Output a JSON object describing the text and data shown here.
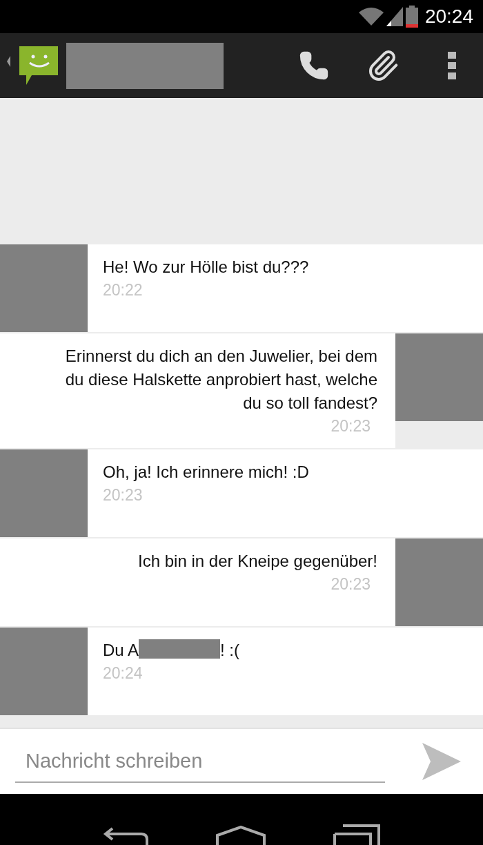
{
  "status_bar": {
    "time": "20:24",
    "battery_low": true
  },
  "action_bar": {
    "contact_redacted": true
  },
  "messages": [
    {
      "kind": "received",
      "segments": [
        {
          "kind": "text",
          "text": "He! Wo zur Hölle bist du???"
        }
      ],
      "time": "20:22"
    },
    {
      "kind": "sent",
      "segments": [
        {
          "kind": "text",
          "text": "Erinnerst du dich an den Juwelier, bei dem du diese Halskette anprobiert hast, welche du so toll fandest?"
        }
      ],
      "time": "20:23"
    },
    {
      "kind": "received",
      "segments": [
        {
          "kind": "text",
          "text": "Oh, ja! Ich erinnere mich! :D"
        }
      ],
      "time": "20:23"
    },
    {
      "kind": "sent",
      "segments": [
        {
          "kind": "text",
          "text": "Ich bin in der Kneipe gegenüber!"
        }
      ],
      "time": "20:23"
    },
    {
      "kind": "received",
      "segments": [
        {
          "kind": "text",
          "text": "Du A"
        },
        {
          "kind": "redaction"
        },
        {
          "kind": "text",
          "text": "! :("
        }
      ],
      "time": "20:24"
    }
  ],
  "composer": {
    "placeholder": "Nachricht schreiben"
  }
}
